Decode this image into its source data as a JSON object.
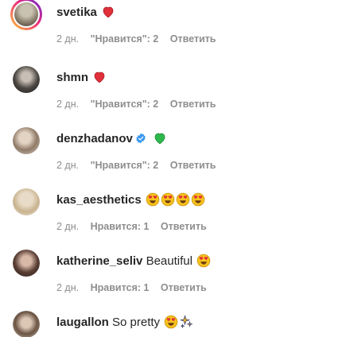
{
  "comments": [
    {
      "username": "svetika",
      "text": "",
      "emojis": [
        "red-heart"
      ],
      "verified": false,
      "time": "2 дн.",
      "likes": "\"Нравится\": 2",
      "reply": "Ответить",
      "story_ring": true
    },
    {
      "username": "shmn",
      "text": "",
      "emojis": [
        "red-heart"
      ],
      "verified": false,
      "time": "2 дн.",
      "likes": "\"Нравится\": 2",
      "reply": "Ответить",
      "story_ring": false
    },
    {
      "username": "denzhadanov",
      "text": "",
      "emojis": [
        "green-heart"
      ],
      "verified": true,
      "time": "2 дн.",
      "likes": "\"Нравится\": 2",
      "reply": "Ответить",
      "story_ring": false
    },
    {
      "username": "kas_aesthetics",
      "text": "",
      "emojis": [
        "heart-eyes",
        "heart-eyes",
        "heart-eyes",
        "heart-eyes"
      ],
      "verified": false,
      "time": "2 дн.",
      "likes": "Нравится: 1",
      "reply": "Ответить",
      "story_ring": false
    },
    {
      "username": "katherine_seliv",
      "text": "Beautiful",
      "emojis": [
        "heart-eyes"
      ],
      "verified": false,
      "time": "2 дн.",
      "likes": "Нравится: 1",
      "reply": "Ответить",
      "story_ring": false
    },
    {
      "username": "laugallon",
      "text": "So pretty",
      "emojis": [
        "heart-eyes",
        "sparkles"
      ],
      "verified": false,
      "time": "",
      "likes": "",
      "reply": "",
      "story_ring": false
    }
  ],
  "colors": {
    "username": "#262626",
    "meta": "#8e8e8e",
    "verified": "#3897f0",
    "red_heart": "#e0303a",
    "green_heart": "#2db84b"
  }
}
